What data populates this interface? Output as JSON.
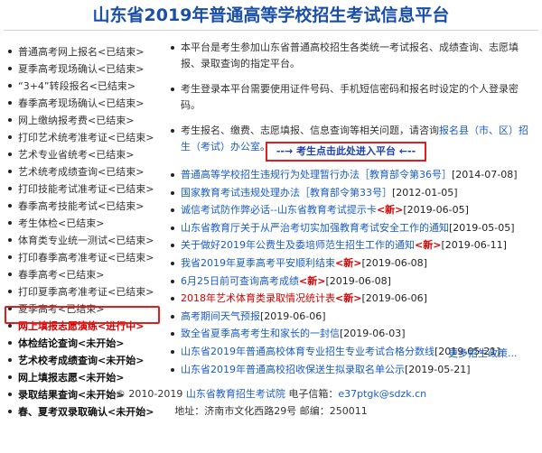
{
  "header": {
    "title": "山东省2019年普通高等学校招生考试信息平台"
  },
  "left_menu": [
    {
      "label": "普通高考网上报名<已结束>",
      "style": "normal"
    },
    {
      "label": "夏季高考现场确认<已结束>",
      "style": "normal"
    },
    {
      "label": "“3+4”转段报名<已结束>",
      "style": "normal"
    },
    {
      "label": "春季高考现场确认<已结束>",
      "style": "normal"
    },
    {
      "label": "网上缴纳报考费<已结束>",
      "style": "normal"
    },
    {
      "label": "打印艺术统考准考证<已结束>",
      "style": "normal"
    },
    {
      "label": "艺术专业省统考<已结束>",
      "style": "normal"
    },
    {
      "label": "艺术统考成绩查询<已结束>",
      "style": "normal"
    },
    {
      "label": "打印技能考试准考证<已结束>",
      "style": "normal"
    },
    {
      "label": "春季高考技能考试<已结束>",
      "style": "normal"
    },
    {
      "label": "考生体检<已结束>",
      "style": "normal"
    },
    {
      "label": "体育类专业统一测试<已结束>",
      "style": "normal"
    },
    {
      "label": "打印春季高考准考证<已结束>",
      "style": "normal"
    },
    {
      "label": "春季高考<已结束>",
      "style": "normal"
    },
    {
      "label": "打印夏季高考准考证<已结束>",
      "style": "normal"
    },
    {
      "label": "夏季高考<已结束>",
      "style": "normal"
    },
    {
      "label": "网上填报志愿演练<进行中>",
      "style": "active"
    },
    {
      "label": "体检结论查询<未开始>",
      "style": "bold"
    },
    {
      "label": "艺术校考成绩查询<未开始>",
      "style": "bold"
    },
    {
      "label": "网上填报志愿<未开始>",
      "style": "bold"
    },
    {
      "label": "录取结果查询<未开始>",
      "style": "bold"
    },
    {
      "label": "春、夏考双录取确认<未开始>",
      "style": "bold"
    }
  ],
  "notices": [
    {
      "text": "本平台是考生参加山东省普通高校招生各类统一考试报名、成绩查询、志愿填报、录取查询的指定平台。"
    },
    {
      "text": "考生登录本平台需要使用证件号码、手机短信密码和报名时设定的个人登录密码。"
    },
    {
      "text": "考生报名、缴费、志愿填报、信息查询等相关问题，请咨询",
      "link": "报名县（市、区）招生（考试）办公室",
      "suffix": "。"
    }
  ],
  "enter_link": "--→ 考生点击此处进入平台 ←--",
  "news": [
    {
      "title": "普通高等学校招生违规行为处理暂行办法［教育部令第36号］",
      "date": "[2014-07-08]",
      "new": false,
      "red": false
    },
    {
      "title": "国家教育考试违规处理办法［教育部令第33号］",
      "date": "[2012-01-05]",
      "new": false,
      "red": false
    },
    {
      "title": "诚信考试防作弊必话--山东省教育考试提示卡",
      "date": "[2019-06-05]",
      "new": true,
      "red": false
    },
    {
      "title": "山东省教育厅关于从严治考切实加强教育考试安全工作的通知",
      "date": "[2019-05-05]",
      "new": false,
      "red": false
    },
    {
      "title": "关于做好2019年公费生及委培师范生招生工作的通知",
      "date": "[2019-06-11]",
      "new": true,
      "red": false
    },
    {
      "title": "我省2019年夏季高考平安顺利结束",
      "date": "[2019-06-08]",
      "new": true,
      "red": false
    },
    {
      "title": "6月25日前可查询高考成绩",
      "date": "[2019-06-08]",
      "new": true,
      "red": false
    },
    {
      "title": "2018年艺术体育类录取情况统计表",
      "date": "[2019-06-06]",
      "new": true,
      "red": true
    },
    {
      "title": "高考期间天气预报",
      "date": "[2019-06-06]",
      "new": false,
      "red": false
    },
    {
      "title": "致全省夏季高考考生和家长的一封信",
      "date": "[2019-06-03]",
      "new": false,
      "red": false
    },
    {
      "title": "山东省2019年普通高校体育专业招生专业考试合格分数线",
      "date": "[2019-05-21]",
      "new": false,
      "red": false
    },
    {
      "title": "山东省2019年普通高校招收保送生拟录取名单公示",
      "date": "[2019-05-21]",
      "new": false,
      "red": false
    }
  ],
  "new_tag": "<新>",
  "more_link": "更多招生政策...",
  "footer": {
    "copyright": "© 2010-2019 ",
    "org": "山东省教育招生考试院",
    "email_label": "电子信箱：",
    "email": "e37ptgk@sdzk.cn",
    "address": "地址：济南市文化西路29号 邮编：250011"
  },
  "colors": {
    "title": "#1a4fa8",
    "link": "#1a5cc8",
    "highlight": "#e21d1d"
  }
}
